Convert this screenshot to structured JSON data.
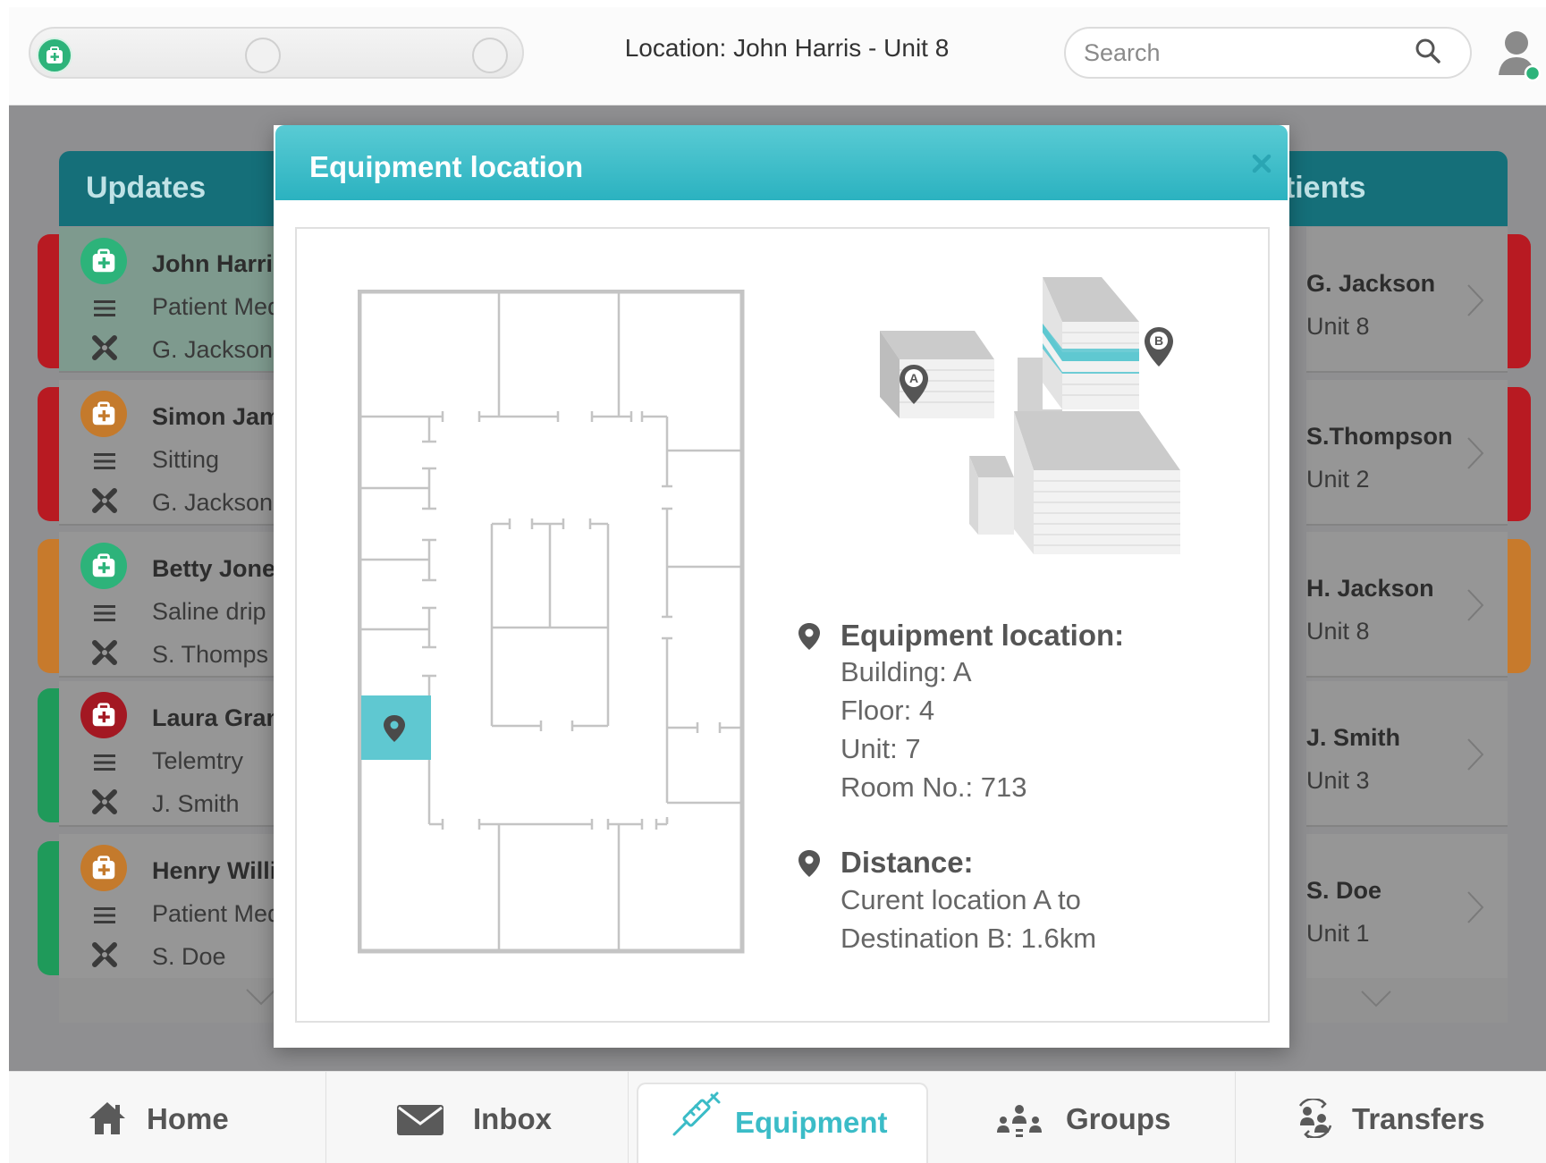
{
  "header": {
    "location_title": "Location: John Harris - Unit 8",
    "search_placeholder": "Search"
  },
  "updates": {
    "title": "Updates",
    "cards": [
      {
        "name": "John Harris",
        "line2": "Patient Med",
        "line3": "G. Jackson",
        "kit_color": "#2db37a",
        "strip_color": "#b81a22",
        "selected": true
      },
      {
        "name": "Simon Jam",
        "line2": "Sitting",
        "line3": "G. Jackson",
        "kit_color": "#c47a2c",
        "strip_color": "#b81a22",
        "selected": false
      },
      {
        "name": "Betty Jone",
        "line2": "Saline drip",
        "line3": "S. Thomps",
        "kit_color": "#2db37a",
        "strip_color": "#c77a2c",
        "selected": false
      },
      {
        "name": "Laura Gran",
        "line2": "Telemtry",
        "line3": "J. Smith",
        "kit_color": "#a31822",
        "strip_color": "#1f9a5a",
        "selected": false
      },
      {
        "name": "Henry Willi",
        "line2": "Patient Med",
        "line3": "S. Doe",
        "kit_color": "#c47a2c",
        "strip_color": "#1f9a5a",
        "selected": false
      }
    ]
  },
  "patients": {
    "title": "Patients",
    "title_visible": "atients",
    "cards": [
      {
        "name": "G. Jackson",
        "unit": "Unit 8",
        "strip_color": "#b81a22"
      },
      {
        "name": "S.Thompson",
        "unit": "Unit 2",
        "strip_color": "#b81a22"
      },
      {
        "name": "H. Jackson",
        "unit": "Unit 8",
        "strip_color": "#c77a2c"
      },
      {
        "name": "J. Smith",
        "unit": "Unit 3",
        "strip_color": ""
      },
      {
        "name": "S. Doe",
        "unit": "Unit 1",
        "strip_color": ""
      }
    ]
  },
  "modal": {
    "title": "Equipment location",
    "map_markers": {
      "a": "A",
      "b": "B"
    },
    "equipment_heading": "Equipment location:",
    "building": "Building: A",
    "floor": "Floor: 4",
    "unit": "Unit: 7",
    "room": "Room No.: 713",
    "distance_heading": "Distance:",
    "distance_line1": "Curent location A to",
    "distance_line2": "Destination B: 1.6km",
    "accent": "#42bfca"
  },
  "nav": {
    "items": [
      {
        "label": "Home",
        "icon": "home-icon"
      },
      {
        "label": "Inbox",
        "icon": "envelope-icon"
      },
      {
        "label": "Equipment",
        "icon": "syringe-icon",
        "active": true
      },
      {
        "label": "Groups",
        "icon": "groups-icon"
      },
      {
        "label": "Transfers",
        "icon": "transfers-icon"
      }
    ]
  }
}
